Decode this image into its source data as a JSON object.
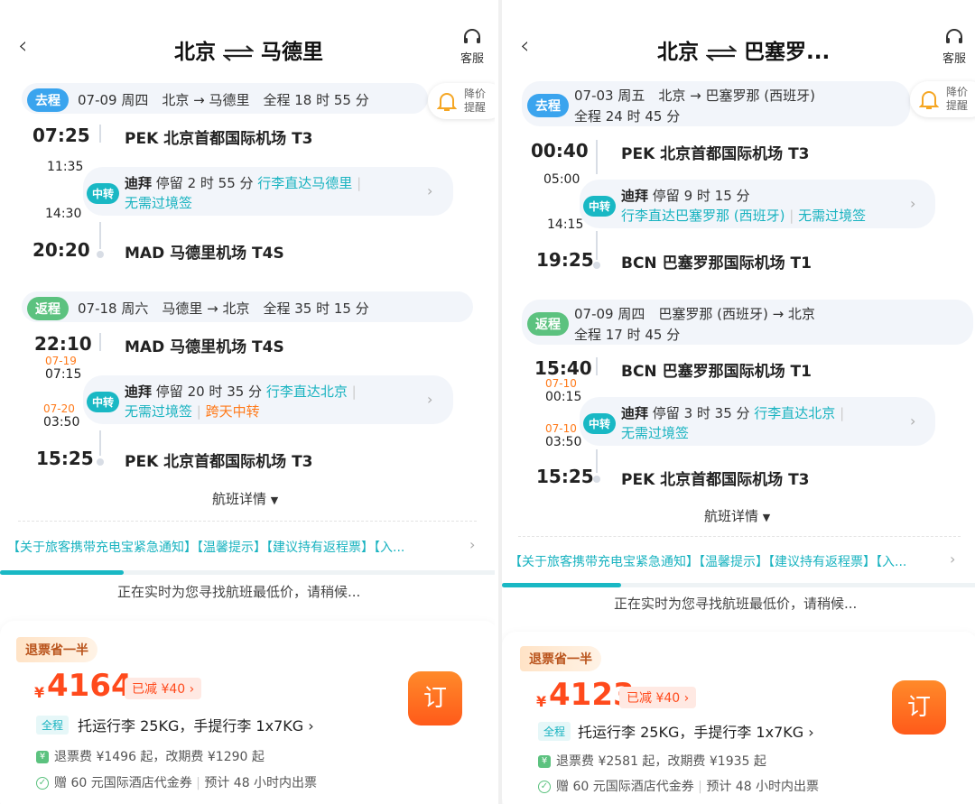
{
  "panels": [
    {
      "header": {
        "from": "北京",
        "to": "马德里",
        "service_label": "客服"
      },
      "remind": {
        "line1": "降价",
        "line2": "提醒"
      },
      "segments": [
        {
          "tag": "去程",
          "info": "07-09 周四　北京 → 马德里　全程 18 时 55 分",
          "dep_time": "07:25",
          "dep_airport": "PEK 北京首都国际机场 T3",
          "transfer": {
            "arr_time": "11:35",
            "arr_date": "",
            "dep_time": "14:30",
            "dep_date": "",
            "tag": "中转",
            "city": "迪拜",
            "stay": "停留 2 时 55 分",
            "luggage": "行李直达马德里",
            "visa": "无需过境签",
            "extra": ""
          },
          "arr_time": "20:20",
          "arr_airport": "MAD 马德里机场 T4S"
        },
        {
          "tag": "返程",
          "info": "07-18 周六　马德里 → 北京　全程 35 时 15 分",
          "dep_time": "22:10",
          "dep_airport": "MAD 马德里机场 T4S",
          "transfer": {
            "arr_time": "07:15",
            "arr_date": "07-19",
            "dep_time": "03:50",
            "dep_date": "07-20",
            "tag": "中转",
            "city": "迪拜",
            "stay": "停留 20 时 35 分",
            "luggage": "行李直达北京",
            "visa": "无需过境签",
            "extra": "跨天中转"
          },
          "arr_time": "15:25",
          "arr_airport": "PEK 北京首都国际机场 T3"
        }
      ],
      "details_link": "航班详情",
      "notice": "【关于旅客携带充电宝紧急通知】【温馨提示】【建议持有返程票】【入...",
      "loading_text": "正在实时为您寻找航班最低价，请稍候...",
      "loading_progress": 0.25,
      "offer": {
        "badge": "退票省一半",
        "currency": "¥",
        "price": "4164",
        "discount": "已减 ¥40",
        "book_label": "订",
        "cabin": "全程",
        "baggage": "托运行李 25KG，手提行李 1x7KG",
        "fee": "退票费 ¥1496 起，改期费 ¥1290 起",
        "gift": "赠 60 元国际酒店代金券",
        "ticketing": "预计 48 小时内出票"
      }
    },
    {
      "header": {
        "from": "北京",
        "to": "巴塞罗...",
        "service_label": "客服"
      },
      "remind": {
        "line1": "降价",
        "line2": "提醒"
      },
      "segments": [
        {
          "tag": "去程",
          "info": "07-03 周五　北京 → 巴塞罗那 (西班牙)",
          "info2": "全程 24 时 45 分",
          "dep_time": "00:40",
          "dep_airport": "PEK 北京首都国际机场 T3",
          "transfer": {
            "arr_time": "05:00",
            "arr_date": "",
            "dep_time": "14:15",
            "dep_date": "",
            "tag": "中转",
            "city": "迪拜",
            "stay": "停留 9 时 15 分",
            "luggage": "行李直达巴塞罗那 (西班牙)",
            "visa": "无需过境签",
            "extra": ""
          },
          "arr_time": "19:25",
          "arr_airport": "BCN 巴塞罗那国际机场 T1"
        },
        {
          "tag": "返程",
          "info": "07-09 周四　巴塞罗那 (西班牙) → 北京",
          "info2": "全程 17 时 45 分",
          "dep_time": "15:40",
          "dep_airport": "BCN 巴塞罗那国际机场 T1",
          "transfer": {
            "arr_time": "00:15",
            "arr_date": "07-10",
            "dep_time": "03:50",
            "dep_date": "07-10",
            "tag": "中转",
            "city": "迪拜",
            "stay": "停留 3 时 35 分",
            "luggage": "行李直达北京",
            "visa": "无需过境签",
            "extra": ""
          },
          "arr_time": "15:25",
          "arr_airport": "PEK 北京首都国际机场 T3"
        }
      ],
      "details_link": "航班详情",
      "notice": "【关于旅客携带充电宝紧急通知】【温馨提示】【建议持有返程票】【入...",
      "loading_text": "正在实时为您寻找航班最低价，请稍候...",
      "loading_progress": 0.25,
      "offer": {
        "badge": "退票省一半",
        "currency": "¥",
        "price": "4123",
        "discount": "已减 ¥40",
        "book_label": "订",
        "cabin": "全程",
        "baggage": "托运行李 25KG，手提行李 1x7KG",
        "fee": "退票费 ¥2581 起，改期费 ¥1935 起",
        "gift": "赠 60 元国际酒店代金券",
        "ticketing": "预计 48 小时内出票"
      }
    }
  ]
}
